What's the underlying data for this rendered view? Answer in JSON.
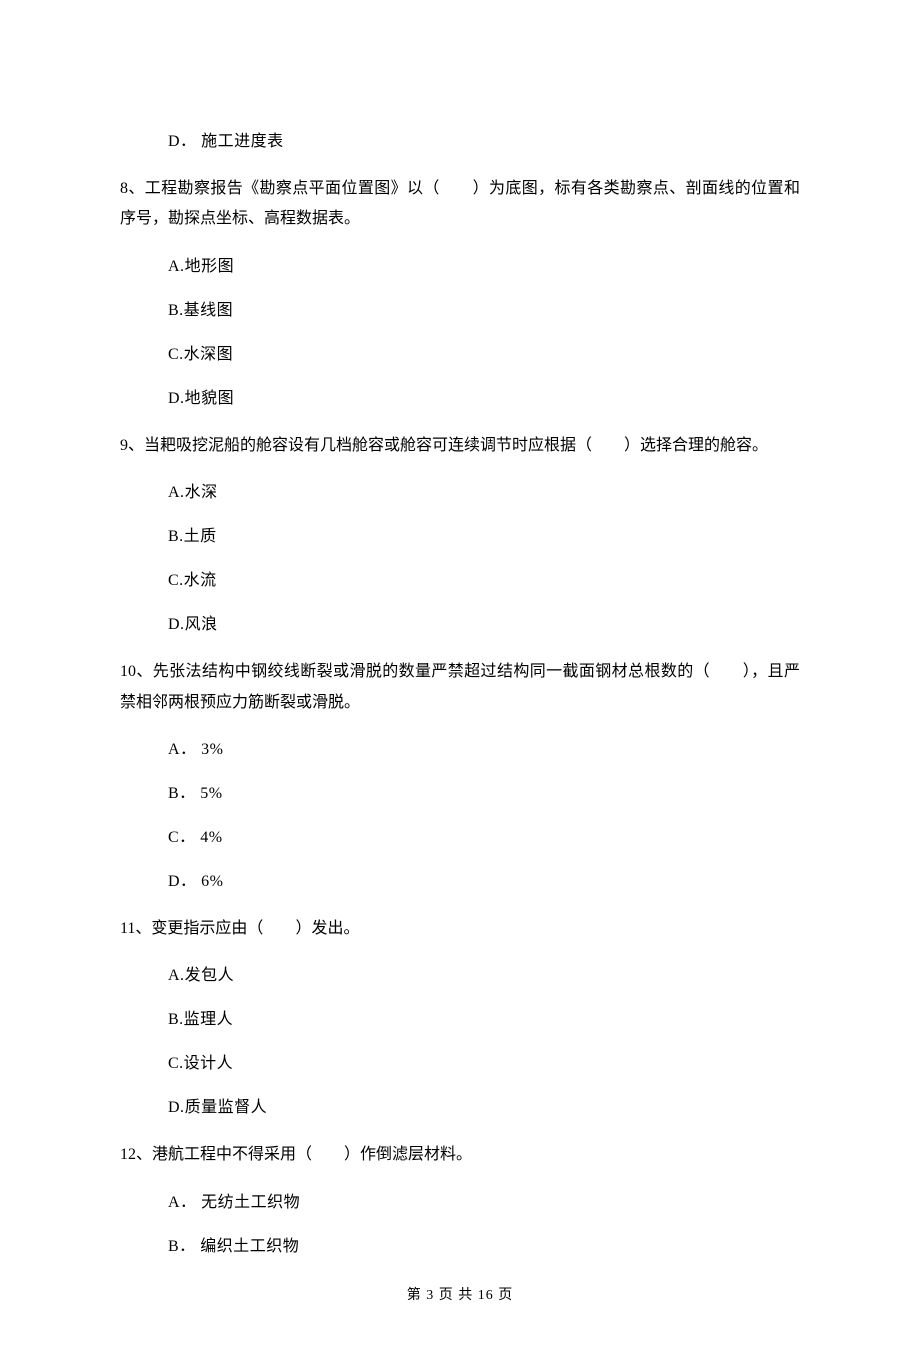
{
  "orphan_option": {
    "label": "D．",
    "text": "施工进度表"
  },
  "questions": [
    {
      "number": "8、",
      "stem_before": "工程勘察报告《勘察点平面位置图》以（",
      "blank": "　　",
      "stem_after": "）为底图，标有各类勘察点、剖面线的位置和序号，勘探点坐标、高程数据表。",
      "options": [
        {
          "label": "A.",
          "text": "地形图"
        },
        {
          "label": "B.",
          "text": "基线图"
        },
        {
          "label": "C.",
          "text": "水深图"
        },
        {
          "label": "D.",
          "text": "地貌图"
        }
      ]
    },
    {
      "number": "9、",
      "stem_before": "当耙吸挖泥船的舱容设有几档舱容或舱容可连续调节时应根据（",
      "blank": "　　",
      "stem_after": "）选择合理的舱容。",
      "options": [
        {
          "label": "A.",
          "text": "水深"
        },
        {
          "label": "B.",
          "text": "土质"
        },
        {
          "label": "C.",
          "text": "水流"
        },
        {
          "label": "D.",
          "text": "风浪"
        }
      ]
    },
    {
      "number": "10、",
      "stem_before": "先张法结构中钢绞线断裂或滑脱的数量严禁超过结构同一截面钢材总根数的（",
      "blank": "　　",
      "stem_after": "），且严禁相邻两根预应力筋断裂或滑脱。",
      "options": [
        {
          "label": "A．",
          "text": "3%"
        },
        {
          "label": "B．",
          "text": "5%"
        },
        {
          "label": "C．",
          "text": "4%"
        },
        {
          "label": "D．",
          "text": "6%"
        }
      ]
    },
    {
      "number": "11、",
      "stem_before": "变更指示应由（",
      "blank": "　　",
      "stem_after": "）发出。",
      "options": [
        {
          "label": "A.",
          "text": "发包人"
        },
        {
          "label": "B.",
          "text": "监理人"
        },
        {
          "label": "C.",
          "text": "设计人"
        },
        {
          "label": "D.",
          "text": "质量监督人"
        }
      ]
    },
    {
      "number": "12、",
      "stem_before": "港航工程中不得采用（",
      "blank": "　　",
      "stem_after": "）作倒滤层材料。",
      "options": [
        {
          "label": "A．",
          "text": "无纺土工织物"
        },
        {
          "label": "B．",
          "text": "编织土工织物"
        }
      ]
    }
  ],
  "footer": {
    "prefix": "第 ",
    "current": "3",
    "middle": " 页 共 ",
    "total": "16",
    "suffix": " 页"
  }
}
